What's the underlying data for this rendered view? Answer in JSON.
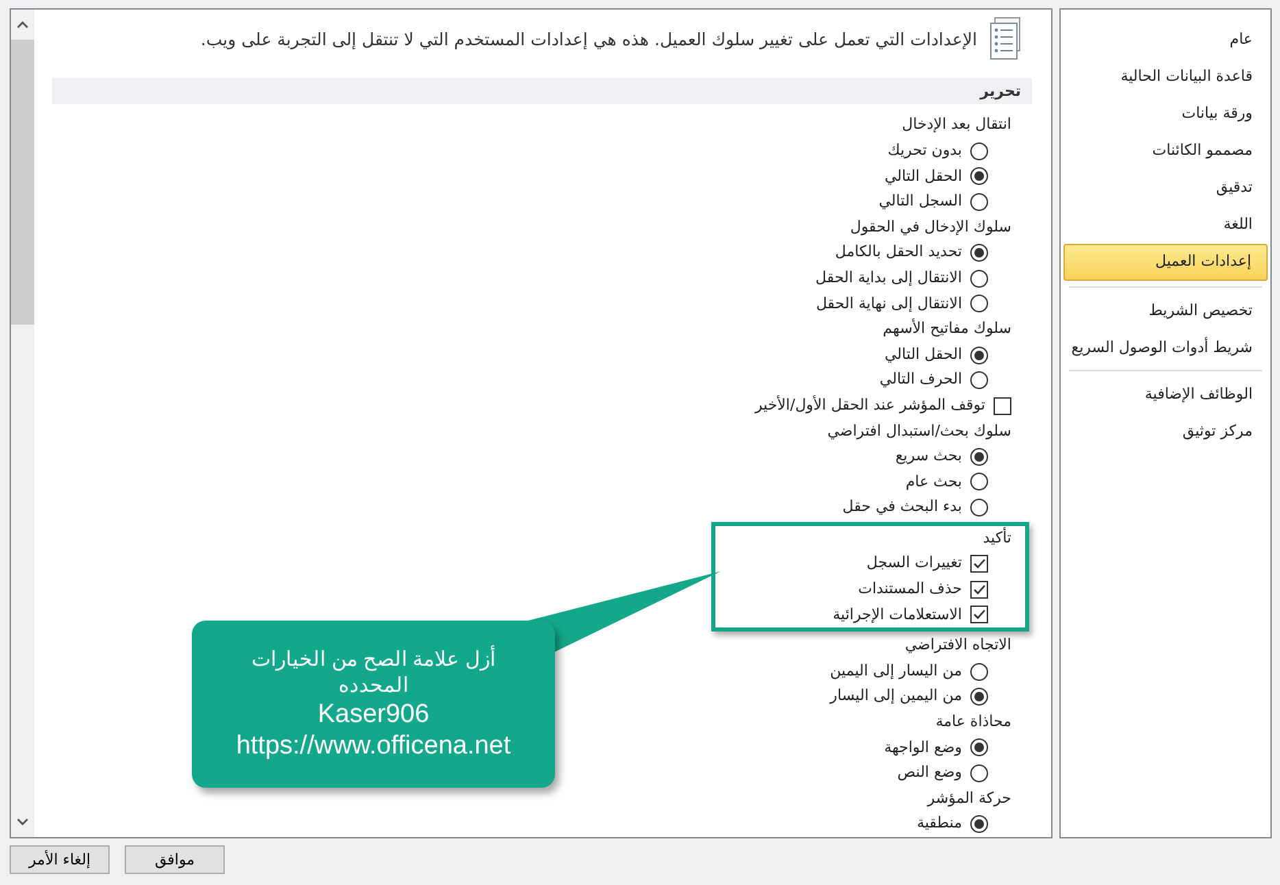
{
  "main": {
    "description": "الإعدادات التي تعمل على تغيير سلوك العميل. هذه هي إعدادات المستخدم التي لا تنتقل إلى التجربة على ويب.",
    "section": {
      "title": "تحرير",
      "groups": [
        {
          "kind": "group",
          "label": "انتقال بعد الإدخال",
          "highlighted": false,
          "options": [
            {
              "kind": "radio",
              "label": "بدون تحريك",
              "selected": false
            },
            {
              "kind": "radio",
              "label": "الحقل التالي",
              "selected": true
            },
            {
              "kind": "radio",
              "label": "السجل التالي",
              "selected": false
            }
          ]
        },
        {
          "kind": "group",
          "label": "سلوك الإدخال في الحقول",
          "highlighted": false,
          "options": [
            {
              "kind": "radio",
              "label": "تحديد الحقل بالكامل",
              "selected": true
            },
            {
              "kind": "radio",
              "label": "الانتقال إلى بداية الحقل",
              "selected": false
            },
            {
              "kind": "radio",
              "label": "الانتقال إلى نهاية الحقل",
              "selected": false
            }
          ]
        },
        {
          "kind": "group",
          "label": "سلوك مفاتيح الأسهم",
          "highlighted": false,
          "options": [
            {
              "kind": "radio",
              "label": "الحقل التالي",
              "selected": true
            },
            {
              "kind": "radio",
              "label": "الحرف التالي",
              "selected": false
            }
          ]
        },
        {
          "kind": "checkbox",
          "label": "توقف المؤشر عند الحقل الأول/الأخير",
          "checked": false
        },
        {
          "kind": "group",
          "label": "سلوك بحث/استبدال افتراضي",
          "highlighted": false,
          "options": [
            {
              "kind": "radio",
              "label": "بحث سريع",
              "selected": true
            },
            {
              "kind": "radio",
              "label": "بحث عام",
              "selected": false
            },
            {
              "kind": "radio",
              "label": "بدء البحث في حقل",
              "selected": false
            }
          ]
        },
        {
          "kind": "group",
          "label": "تأكيد",
          "highlighted": true,
          "options": [
            {
              "kind": "checkbox",
              "label": "تغييرات السجل",
              "checked": true
            },
            {
              "kind": "checkbox",
              "label": "حذف المستندات",
              "checked": true
            },
            {
              "kind": "checkbox",
              "label": "الاستعلامات الإجرائية",
              "checked": true
            }
          ]
        },
        {
          "kind": "group",
          "label": "الاتجاه الافتراضي",
          "highlighted": false,
          "options": [
            {
              "kind": "radio",
              "label": "من اليسار إلى اليمين",
              "selected": false
            },
            {
              "kind": "radio",
              "label": "من اليمين إلى اليسار",
              "selected": true
            }
          ]
        },
        {
          "kind": "group",
          "label": "محاذاة عامة",
          "highlighted": false,
          "options": [
            {
              "kind": "radio",
              "label": "وضع الواجهة",
              "selected": true
            },
            {
              "kind": "radio",
              "label": "وضع النص",
              "selected": false
            }
          ]
        },
        {
          "kind": "group",
          "label": "حركة المؤشر",
          "highlighted": false,
          "options": [
            {
              "kind": "radio",
              "label": "منطقية",
              "selected": true
            }
          ]
        }
      ]
    }
  },
  "sidebar": {
    "groups": [
      [
        {
          "label": "عام",
          "selected": false
        },
        {
          "label": "قاعدة البيانات الحالية",
          "selected": false
        },
        {
          "label": "ورقة بيانات",
          "selected": false
        },
        {
          "label": "مصممو الكائنات",
          "selected": false
        },
        {
          "label": "تدقيق",
          "selected": false
        },
        {
          "label": "اللغة",
          "selected": false
        },
        {
          "label": "إعدادات العميل",
          "selected": true
        }
      ],
      [
        {
          "label": "تخصيص الشريط",
          "selected": false
        },
        {
          "label": "شريط أدوات الوصول السريع",
          "selected": false
        }
      ],
      [
        {
          "label": "الوظائف الإضافية",
          "selected": false
        },
        {
          "label": "مركز توثيق",
          "selected": false
        }
      ]
    ]
  },
  "buttons": {
    "cancel": "إلغاء الأمر",
    "ok": "موافق"
  },
  "callout": {
    "instruction": "أزل علامة الصح من الخيارات المحدده",
    "author": "Kaser906",
    "url": "https://www.officena.net"
  }
}
